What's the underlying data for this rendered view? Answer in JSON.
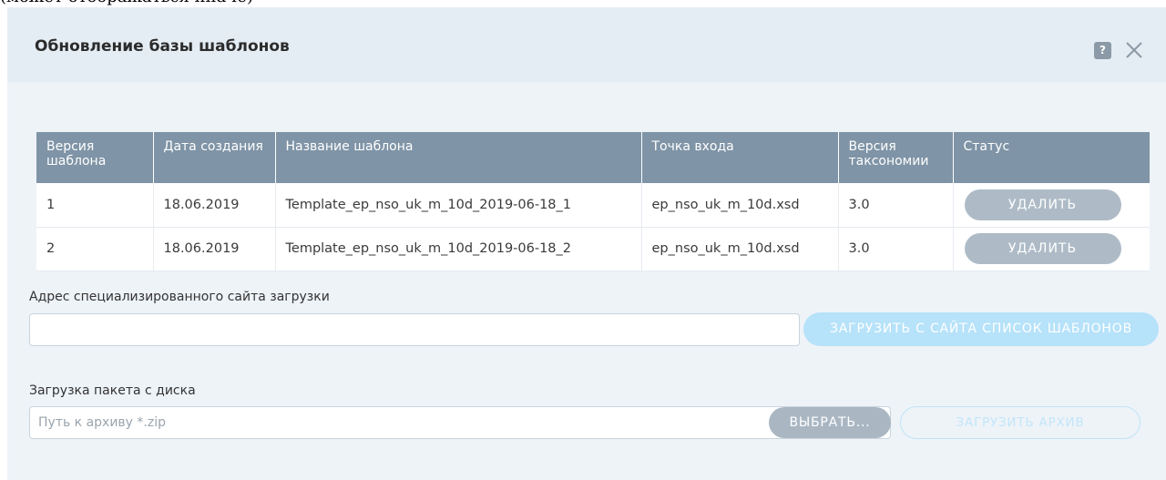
{
  "top_clip_text": "(может отображаться иначе)",
  "dialog": {
    "title": "Обновление базы шаблонов",
    "help_glyph": "?",
    "icons": {
      "help": "help-icon",
      "close": "close-icon"
    }
  },
  "table": {
    "headers": {
      "version": "Версия шаблона",
      "created": "Дата создания",
      "name": "Название шаблона",
      "entry": "Точка входа",
      "taxonomy": "Версия таксономии",
      "status": "Статус"
    },
    "rows": [
      {
        "version": "1",
        "created": "18.06.2019",
        "name": "Template_ep_nso_uk_m_10d_2019-06-18_1",
        "entry": "ep_nso_uk_m_10d.xsd",
        "taxonomy": "3.0",
        "action": "УДАЛИТЬ"
      },
      {
        "version": "2",
        "created": "18.06.2019",
        "name": "Template_ep_nso_uk_m_10d_2019-06-18_2",
        "entry": "ep_nso_uk_m_10d.xsd",
        "taxonomy": "3.0",
        "action": "УДАЛИТЬ"
      }
    ]
  },
  "site": {
    "label": "Адрес специализированного сайта загрузки",
    "value": "",
    "load_button": "ЗАГРУЗИТЬ С САЙТА СПИСОК ШАБЛОНОВ"
  },
  "disk": {
    "label": "Загрузка пакета с диска",
    "placeholder": "Путь к архиву *.zip",
    "choose_button": "ВЫБРАТЬ...",
    "upload_button": "ЗАГРУЗИТЬ АРХИВ"
  },
  "colors": {
    "header_bg": "#e5edf4",
    "body_bg": "#eef3f8",
    "table_header": "#7f94a6",
    "button_disabled_gray": "#aebbc7",
    "button_disabled_blue": "#b6e2fa"
  }
}
